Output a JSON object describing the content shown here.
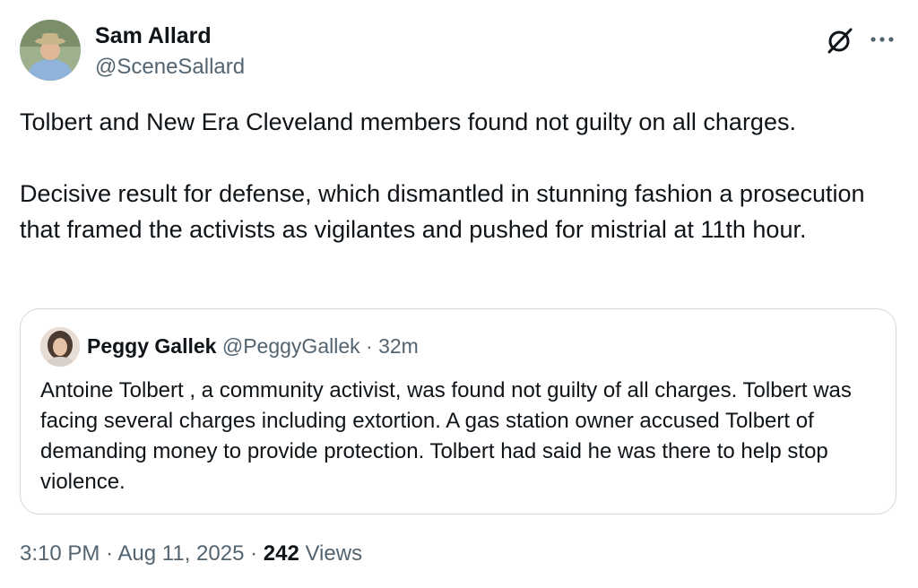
{
  "author": {
    "name": "Sam Allard",
    "handle": "@SceneSallard",
    "avatar_icon": "profile-photo"
  },
  "header_icons": [
    "grok-icon",
    "more-options-icon"
  ],
  "tweet": {
    "paragraphs": [
      "Tolbert and New Era Cleveland members found not guilty on all charges.",
      "Decisive result for defense, which dismantled in stunning fashion a prosecution that framed the activists as vigilantes and pushed for mistrial at 11th hour."
    ]
  },
  "quote": {
    "name": "Peggy Gallek",
    "handle": "@PeggyGallek",
    "separator": "·",
    "time": "32m",
    "text": "Antoine Tolbert , a community activist, was found not guilty of all charges. Tolbert was facing several charges including extortion.  A gas station owner accused Tolbert of demanding money to provide protection. Tolbert had said he was there to help stop violence."
  },
  "footer": {
    "time": "3:10 PM",
    "separator": "·",
    "date": "Aug 11, 2025",
    "views_count": "242",
    "views_label": "Views"
  },
  "colors": {
    "text": "#0f1419",
    "secondary": "#536471",
    "border": "#cfd9de"
  }
}
